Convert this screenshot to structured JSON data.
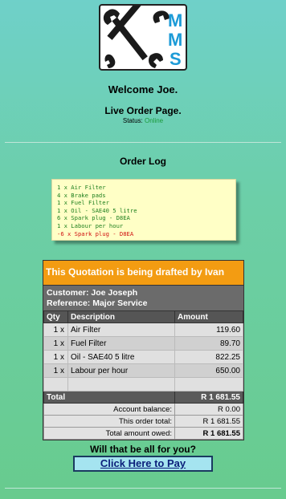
{
  "logo": {
    "letters": [
      "M",
      "M",
      "S"
    ],
    "icon": "crossed-wrenches-icon"
  },
  "header": {
    "welcome": "Welcome Joe.",
    "page_title": "Live Order Page.",
    "status_label": "Status:",
    "status_value": "Online",
    "status_color": "#1a9a3a"
  },
  "order_log": {
    "title": "Order Log",
    "entries": [
      {
        "text": "1 x Air Filter",
        "color": "#1e7f1e"
      },
      {
        "text": "4 x Brake pads",
        "color": "#1e7f1e"
      },
      {
        "text": "1 x Fuel Filter",
        "color": "#1e7f1e"
      },
      {
        "text": "1 x Oil - SAE40 5 litre",
        "color": "#1e7f1e"
      },
      {
        "text": "6 x Spark plug - D8EA",
        "color": "#1e7f1e"
      },
      {
        "text": "1 x Labour per hour",
        "color": "#1e7f1e"
      },
      {
        "text": "-6 x Spark plug - D8EA",
        "color": "#d01010"
      }
    ]
  },
  "quote": {
    "heading": "This Quotation is being drafted by Ivan",
    "customer": "Customer: Joe Joseph",
    "reference": "Reference: Major Service",
    "columns": {
      "qty": "Qty",
      "description": "Description",
      "amount": "Amount"
    },
    "rows": [
      {
        "qty": "1 x",
        "description": "Air Filter",
        "amount": "119.60"
      },
      {
        "qty": "1 x",
        "description": "Fuel Filter",
        "amount": "89.70"
      },
      {
        "qty": "1 x",
        "description": "Oil - SAE40 5 litre",
        "amount": "822.25"
      },
      {
        "qty": "1 x",
        "description": "Labour per hour",
        "amount": "650.00"
      }
    ],
    "total_label": "Total",
    "total_value": "R 1 681.55",
    "account_balance_label": "Account balance:",
    "account_balance_value": "R 0.00",
    "order_total_label": "This order total:",
    "order_total_value": "R 1 681.55",
    "owed_label": "Total amount owed:",
    "owed_value": "R 1 681.55",
    "accent_color": "#f39c12"
  },
  "footer": {
    "question": "Will that be all for you?",
    "pay_button": "Click Here to Pay"
  }
}
